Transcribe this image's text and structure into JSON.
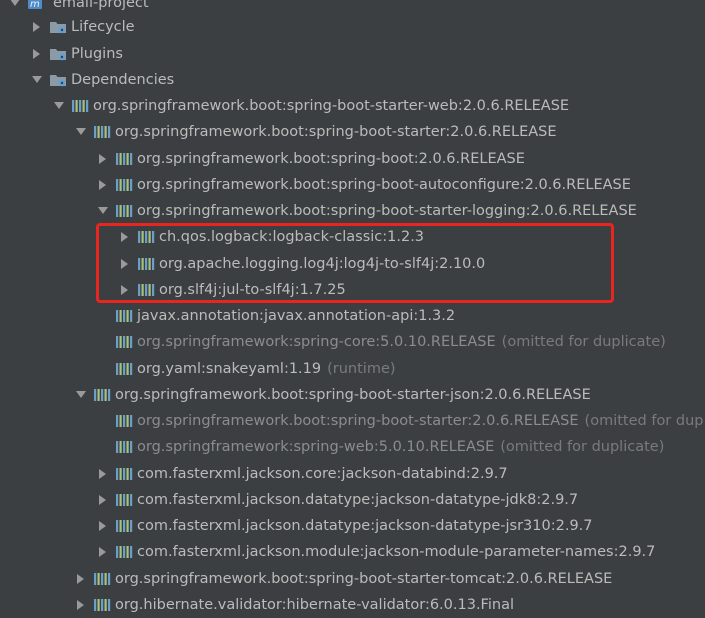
{
  "project": {
    "label": "email-project"
  },
  "nodes": [
    {
      "label": "Lifecycle",
      "suffix": ""
    },
    {
      "label": "Plugins",
      "suffix": ""
    },
    {
      "label": "Dependencies",
      "suffix": ""
    },
    {
      "label": "org.springframework.boot:spring-boot-starter-web:2.0.6.RELEASE",
      "suffix": ""
    },
    {
      "label": "org.springframework.boot:spring-boot-starter:2.0.6.RELEASE",
      "suffix": ""
    },
    {
      "label": "org.springframework.boot:spring-boot:2.0.6.RELEASE",
      "suffix": ""
    },
    {
      "label": "org.springframework.boot:spring-boot-autoconfigure:2.0.6.RELEASE",
      "suffix": ""
    },
    {
      "label": "org.springframework.boot:spring-boot-starter-logging:2.0.6.RELEASE",
      "suffix": ""
    },
    {
      "label": "ch.qos.logback:logback-classic:1.2.3",
      "suffix": ""
    },
    {
      "label": "org.apache.logging.log4j:log4j-to-slf4j:2.10.0",
      "suffix": ""
    },
    {
      "label": "org.slf4j:jul-to-slf4j:1.7.25",
      "suffix": ""
    },
    {
      "label": "javax.annotation:javax.annotation-api:1.3.2",
      "suffix": ""
    },
    {
      "label": "org.springframework:spring-core:5.0.10.RELEASE",
      "suffix": "(omitted for duplicate)"
    },
    {
      "label": "org.yaml:snakeyaml:1.19",
      "suffix": "(runtime)"
    },
    {
      "label": "org.springframework.boot:spring-boot-starter-json:2.0.6.RELEASE",
      "suffix": ""
    },
    {
      "label": "org.springframework.boot:spring-boot-starter:2.0.6.RELEASE",
      "suffix": "(omitted for dup"
    },
    {
      "label": "org.springframework:spring-web:5.0.10.RELEASE",
      "suffix": "(omitted for duplicate)"
    },
    {
      "label": "com.fasterxml.jackson.core:jackson-databind:2.9.7",
      "suffix": ""
    },
    {
      "label": "com.fasterxml.jackson.datatype:jackson-datatype-jdk8:2.9.7",
      "suffix": ""
    },
    {
      "label": "com.fasterxml.jackson.datatype:jackson-datatype-jsr310:2.9.7",
      "suffix": ""
    },
    {
      "label": "com.fasterxml.jackson.module:jackson-module-parameter-names:2.9.7",
      "suffix": ""
    },
    {
      "label": "org.springframework.boot:spring-boot-starter-tomcat:2.0.6.RELEASE",
      "suffix": ""
    },
    {
      "label": "org.hibernate.validator:hibernate-validator:6.0.13.Final",
      "suffix": ""
    }
  ],
  "colors": {
    "highlight": "#e8251f",
    "background": "#3c3f41",
    "text": "#bbbbbb",
    "dim_text": "#8c8c8c"
  }
}
